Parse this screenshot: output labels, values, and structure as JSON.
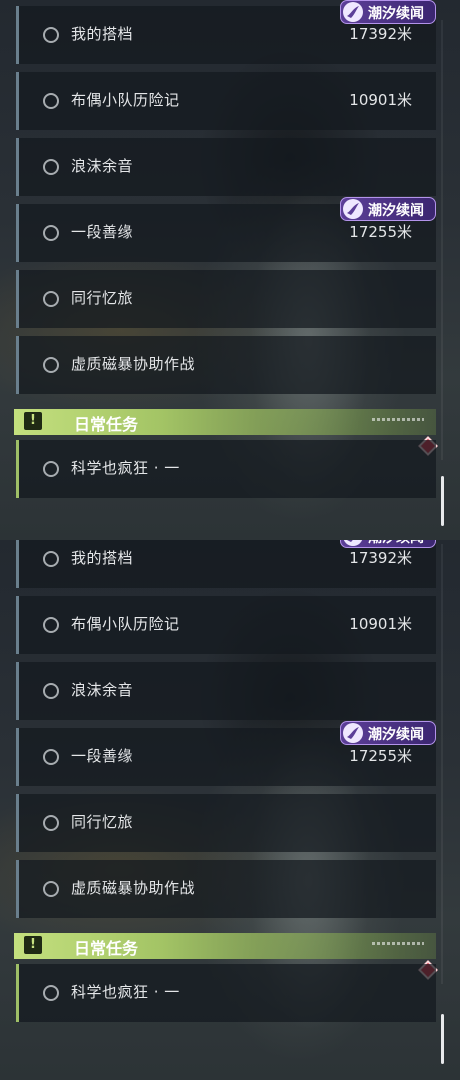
{
  "quests": [
    {
      "name": "我的搭档",
      "distance": "17392米",
      "badge": "潮汐续闻"
    },
    {
      "name": "布偶小队历险记",
      "distance": "10901米",
      "badge": ""
    },
    {
      "name": "浪沫余音",
      "distance": "",
      "badge": ""
    },
    {
      "name": "一段善缘",
      "distance": "17255米",
      "badge": "潮汐续闻"
    },
    {
      "name": "同行忆旅",
      "distance": "",
      "badge": ""
    },
    {
      "name": "虚质磁暴协助作战",
      "distance": "",
      "badge": ""
    }
  ],
  "daily": {
    "header_label": "日常任务",
    "header_icon": "exclamation-icon",
    "quest_name": "科学也疯狂 · 一"
  },
  "badge_label": "潮汐续闻",
  "colors": {
    "badge_purple": "#5c3f98",
    "daily_green": "#a3c465",
    "diamond_red": "#e0344a"
  }
}
